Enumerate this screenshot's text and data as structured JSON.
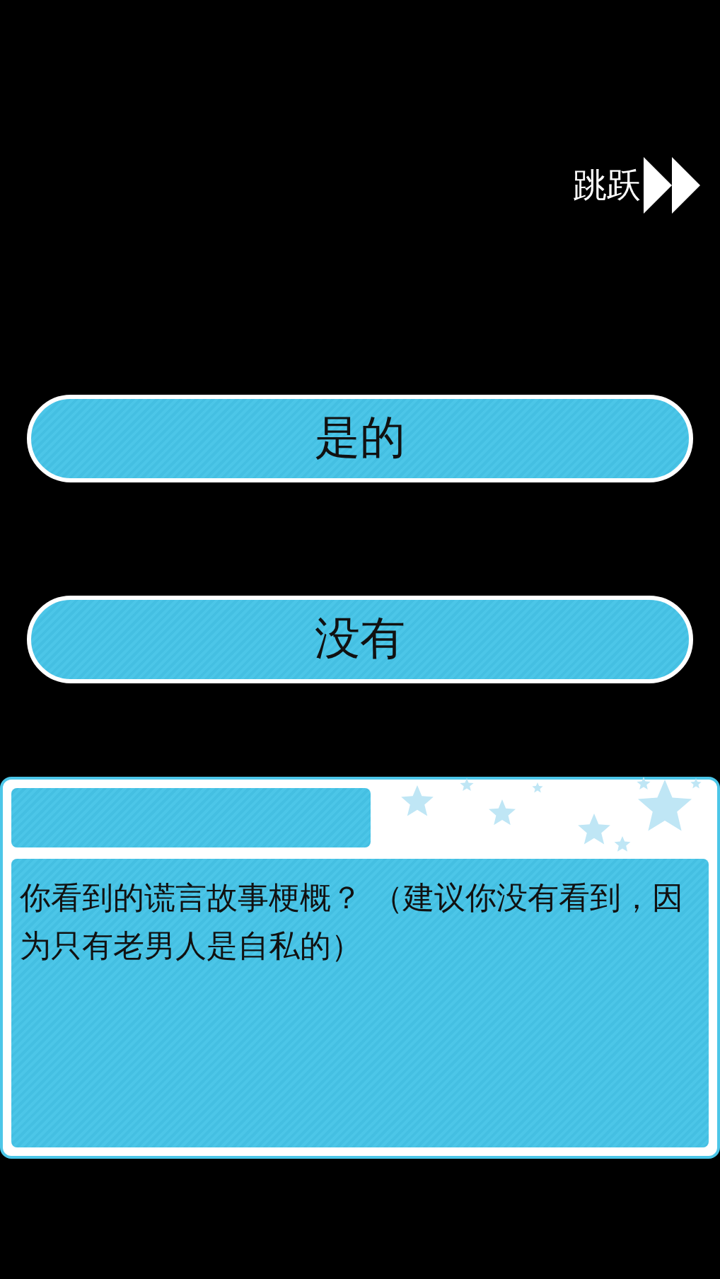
{
  "skip_button": {
    "label": "跳跃"
  },
  "choices": [
    {
      "label": "是的"
    },
    {
      "label": "没有"
    }
  ],
  "dialog": {
    "text": "你看到的谎言故事梗概？ （建议你没有看到，因为只有老男人是自私的）"
  }
}
